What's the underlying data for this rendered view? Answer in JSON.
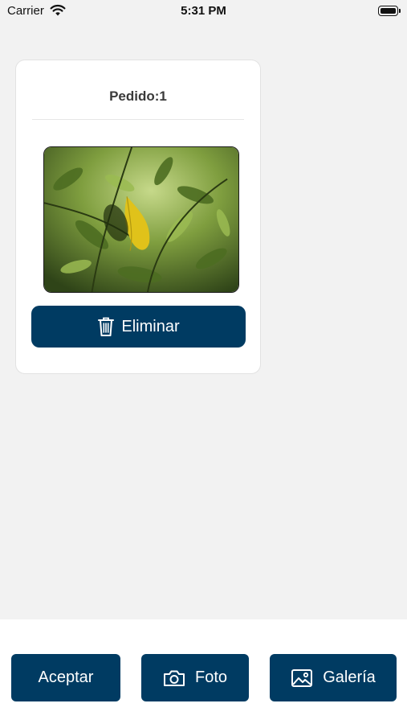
{
  "status_bar": {
    "carrier": "Carrier",
    "time": "5:31 PM",
    "wifi_icon": "wifi-icon",
    "battery_icon": "battery-icon"
  },
  "card": {
    "title": "Pedido:1",
    "delete_label": "Eliminar",
    "delete_icon": "trash-icon"
  },
  "bottom_bar": {
    "accept_label": "Aceptar",
    "photo_label": "Foto",
    "photo_icon": "camera-icon",
    "gallery_label": "Galería",
    "gallery_icon": "image-icon"
  },
  "colors": {
    "primary": "#003b62",
    "background": "#f2f2f2"
  }
}
